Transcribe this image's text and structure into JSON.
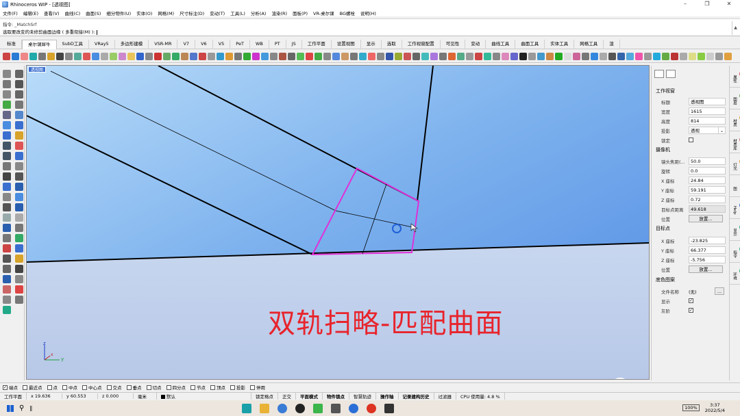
{
  "window": {
    "title": "Rhinoceros WIP - [透视图]",
    "controls": [
      "–",
      "❐",
      "✕"
    ]
  },
  "menu": [
    "文件(F)",
    "编辑(E)",
    "查看(V)",
    "曲线(C)",
    "曲面(S)",
    "细分物件(U)",
    "实体(O)",
    "网格(M)",
    "尺寸标注(D)",
    "变动(T)",
    "工具(L)",
    "分析(A)",
    "渲染(R)",
    "面板(P)",
    "VR-桌尔课",
    "BG螺栓",
    "说明(H)"
  ],
  "command": {
    "line1": "指令: _MatchSrf",
    "line2": "选取要改变的未修剪曲面边缘 ( 多重衔接(M) ):"
  },
  "tabs": [
    "标准",
    "桌尔课犀牛",
    "SubD工具",
    "VRay5",
    "多边形建模",
    "VSR-MR",
    "V7",
    "V6",
    "V5",
    "PeT",
    "WB",
    "PT",
    "JS",
    "工作平面",
    "设置视图",
    "显示",
    "选取",
    "工作视窗配置",
    "可见性",
    "变动",
    "曲线工具",
    "曲面工具",
    "实体工具",
    "网格工具",
    "渲"
  ],
  "viewport": {
    "label": "透视图",
    "overlay_text": "双轨扫略-匹配曲面",
    "axis_x": "x",
    "axis_y": "y",
    "axis_z": "z"
  },
  "properties": {
    "section_viewport": "工作视窗",
    "title_key": "标题",
    "title_val": "透视图",
    "width_key": "宽度",
    "width_val": "1615",
    "height_key": "高度",
    "height_val": "814",
    "proj_key": "投影",
    "proj_val": "透视",
    "lock_key": "锁定",
    "section_camera": "摄像机",
    "focal_key": "镜头焦距(...",
    "focal_val": "50.0",
    "rot_key": "旋转",
    "rot_val": "0.0",
    "cx_key": "X 座标",
    "cx_val": "24.84",
    "cy_key": "Y 座标",
    "cy_val": "59.191",
    "cz_key": "Z 座标",
    "cz_val": "0.72",
    "tdist_key": "目标点距离",
    "tdist_val": "49.618",
    "pos_key": "位置",
    "place_btn": "放置...",
    "section_target": "目标点",
    "tx_key": "X 座标",
    "tx_val": "-23.825",
    "ty_key": "Y 座标",
    "ty_val": "66.377",
    "tz_key": "Z 座标",
    "tz_val": "-5.756",
    "tpos_key": "位置",
    "tplace_btn": "放置...",
    "section_bg": "底色图案",
    "file_key": "文件名称",
    "file_val": "(无)",
    "show_key": "显示",
    "gray_key": "灰阶"
  },
  "side_tabs": [
    "属性",
    "图层",
    "材质",
    "材质库",
    "灯光",
    "已命名视图",
    "Help",
    "显示",
    "指令",
    "环境"
  ],
  "osnap": [
    "端点",
    "最近点",
    "点",
    "中点",
    "中心点",
    "交点",
    "垂点",
    "切点",
    "四分点",
    "节点",
    "顶点",
    "投影",
    "停用"
  ],
  "status": {
    "cplane": "工作平面",
    "x": "x 19.636",
    "y": "y 60.553",
    "z": "z 0.000",
    "unit": "毫米",
    "layer": "默认",
    "items": [
      "锁定格点",
      "正交",
      "平面模式",
      "物件锁点",
      "智慧轨迹",
      "操作轴",
      "记录建构历史",
      "过滤器"
    ],
    "cpu": "CPU 使用量: 4.8 %"
  },
  "taskbar": {
    "battery": "100%",
    "time": "3:37",
    "date": "2022/5/4"
  }
}
